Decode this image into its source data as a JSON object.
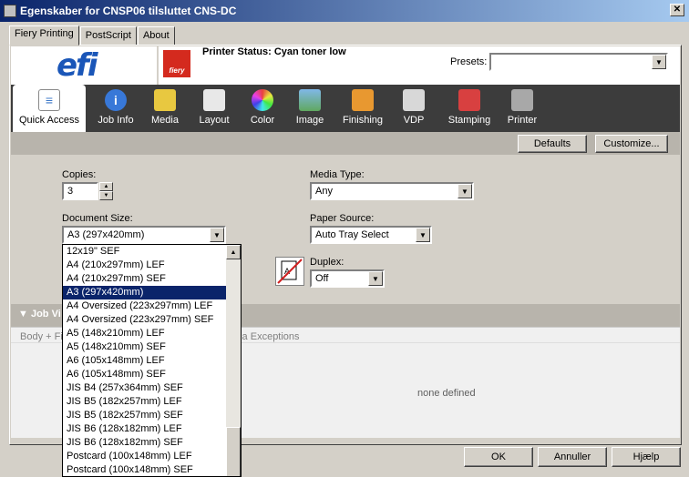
{
  "window": {
    "title": "Egenskaber for CNSP06 tilsluttet CNS-DC"
  },
  "tabs": [
    "Fiery Printing",
    "PostScript",
    "About"
  ],
  "header": {
    "logo": "efi",
    "fiery_label": "fiery",
    "status": "Printer Status: Cyan toner low",
    "presets_label": "Presets:",
    "presets_value": ""
  },
  "toolbar": {
    "items": [
      {
        "label": "Quick Access",
        "icon": "document-icon",
        "color": "#3c78c8"
      },
      {
        "label": "Job Info",
        "icon": "info-icon",
        "color": "#3878d8"
      },
      {
        "label": "Media",
        "icon": "media-icon",
        "color": "#e8c840"
      },
      {
        "label": "Layout",
        "icon": "layout-icon",
        "color": "#e8e8e8"
      },
      {
        "label": "Color",
        "icon": "color-wheel-icon",
        "color": "#e84040"
      },
      {
        "label": "Image",
        "icon": "image-icon",
        "color": "#60a860"
      },
      {
        "label": "Finishing",
        "icon": "finishing-icon",
        "color": "#e89830"
      },
      {
        "label": "VDP",
        "icon": "vdp-icon",
        "color": "#d8d8d8"
      },
      {
        "label": "Stamping",
        "icon": "stamp-icon",
        "color": "#d84040"
      },
      {
        "label": "Printer",
        "icon": "printer-icon",
        "color": "#a8a8a8"
      }
    ]
  },
  "buttons": {
    "defaults": "Defaults",
    "customize": "Customize...",
    "ok": "OK",
    "cancel": "Annuller",
    "help": "Hjælp"
  },
  "form": {
    "copies_label": "Copies:",
    "copies_value": "3",
    "doc_size_label": "Document Size:",
    "doc_size_value": "A3 (297x420mm)",
    "media_type_label": "Media Type:",
    "media_type_value": "Any",
    "paper_source_label": "Paper Source:",
    "paper_source_value": "Auto Tray Select",
    "duplex_label": "Duplex:",
    "duplex_value": "Off"
  },
  "dropdown_items": [
    "12x19\" SEF",
    "A4 (210x297mm) LEF",
    "A4 (210x297mm) SEF",
    "A3 (297x420mm)",
    "A4 Oversized (223x297mm) LEF",
    "A4 Oversized (223x297mm) SEF",
    "A5 (148x210mm) LEF",
    "A5 (148x210mm) SEF",
    "A6 (105x148mm) LEF",
    "A6 (105x148mm) SEF",
    "JIS B4 (257x364mm) SEF",
    "JIS B5 (182x257mm) LEF",
    "JIS B5 (182x257mm) SEF",
    "JIS B6 (128x182mm) LEF",
    "JIS B6 (128x182mm) SEF",
    "Postcard (100x148mm) LEF",
    "Postcard (100x148mm) SEF"
  ],
  "dropdown_selected": 3,
  "jobview": {
    "title": "Job Vi",
    "columns_left": "Body + Fi",
    "columns_right": "dia Exceptions",
    "empty": "none defined"
  }
}
